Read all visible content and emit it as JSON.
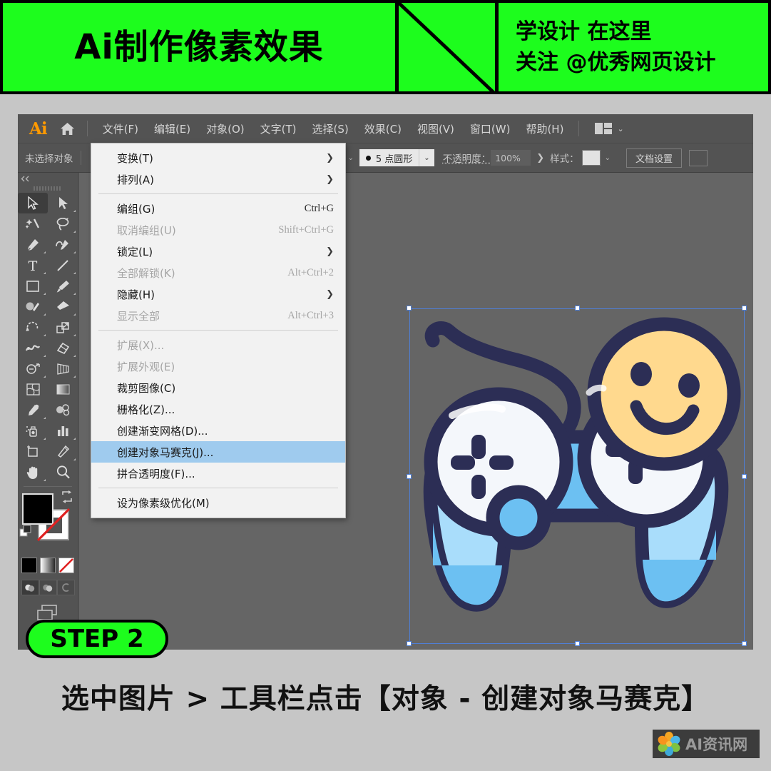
{
  "banner": {
    "title": "Ai制作像素效果",
    "sub_line1": "学设计 在这里",
    "sub_line2": "关注 @优秀网页设计",
    "bg_color": "#1dfd1d",
    "border_color": "#000000"
  },
  "app": {
    "logo": "Ai",
    "home_icon": "home-icon",
    "menu": [
      {
        "label": "文件(F)"
      },
      {
        "label": "编辑(E)"
      },
      {
        "label": "对象(O)"
      },
      {
        "label": "文字(T)"
      },
      {
        "label": "选择(S)"
      },
      {
        "label": "效果(C)"
      },
      {
        "label": "视图(V)"
      },
      {
        "label": "窗口(W)"
      },
      {
        "label": "帮助(H)"
      }
    ],
    "arrange_icon": "arrange-documents-icon",
    "arrange_chevron": "⌄"
  },
  "control_bar": {
    "selection_status": "未选择对象",
    "stroke_swatch_color": "#8f8f8f",
    "brush_label": "5 点圆形",
    "brush_bullet": "●",
    "opacity_label": "不透明度：",
    "opacity_value": "100%",
    "opacity_arrow": "❯",
    "style_label": "样式：",
    "style_swatch_color": "#e2e2e2",
    "document_setup_button": "文档设置"
  },
  "toolbar": {
    "collapse_icon": "double-chevron-left-icon",
    "tools": [
      {
        "name": "selection-tool",
        "glyph": "cursor-arrow",
        "selected": true,
        "corner": false
      },
      {
        "name": "direct-selection-tool",
        "glyph": "cursor-arrow-white",
        "selected": false,
        "corner": true
      },
      {
        "name": "magic-wand-tool",
        "glyph": "magic-wand",
        "selected": false,
        "corner": false
      },
      {
        "name": "lasso-tool",
        "glyph": "lasso",
        "selected": false,
        "corner": true
      },
      {
        "name": "pen-tool",
        "glyph": "pen",
        "selected": false,
        "corner": true
      },
      {
        "name": "curvature-tool",
        "glyph": "curvature",
        "selected": false,
        "corner": true
      },
      {
        "name": "type-tool",
        "glyph": "type-T",
        "selected": false,
        "corner": true
      },
      {
        "name": "line-segment-tool",
        "glyph": "line-segment",
        "selected": false,
        "corner": true
      },
      {
        "name": "rectangle-tool",
        "glyph": "rectangle",
        "selected": false,
        "corner": true
      },
      {
        "name": "paintbrush-tool",
        "glyph": "paintbrush",
        "selected": false,
        "corner": true
      },
      {
        "name": "shaper-tool",
        "glyph": "shaper-pencil",
        "selected": false,
        "corner": true
      },
      {
        "name": "eraser-tool",
        "glyph": "eraser",
        "selected": false,
        "corner": true
      },
      {
        "name": "rotate-tool",
        "glyph": "rotate",
        "selected": false,
        "corner": true
      },
      {
        "name": "scale-tool",
        "glyph": "scale",
        "selected": false,
        "corner": true
      },
      {
        "name": "width-tool",
        "glyph": "width-warp",
        "selected": false,
        "corner": true
      },
      {
        "name": "free-transform-tool",
        "glyph": "free-transform",
        "selected": false,
        "corner": true
      },
      {
        "name": "shape-builder-tool",
        "glyph": "shape-builder",
        "selected": false,
        "corner": true
      },
      {
        "name": "perspective-grid-tool",
        "glyph": "perspective-grid",
        "selected": false,
        "corner": true
      },
      {
        "name": "mesh-tool",
        "glyph": "mesh",
        "selected": false,
        "corner": false
      },
      {
        "name": "gradient-tool",
        "glyph": "gradient",
        "selected": false,
        "corner": false
      },
      {
        "name": "eyedropper-tool",
        "glyph": "eyedropper",
        "selected": false,
        "corner": true
      },
      {
        "name": "blend-tool",
        "glyph": "blend",
        "selected": false,
        "corner": false
      },
      {
        "name": "symbol-sprayer-tool",
        "glyph": "symbol-sprayer",
        "selected": false,
        "corner": true
      },
      {
        "name": "column-graph-tool",
        "glyph": "column-graph",
        "selected": false,
        "corner": true
      },
      {
        "name": "artboard-tool",
        "glyph": "artboard",
        "selected": false,
        "corner": false
      },
      {
        "name": "slice-tool",
        "glyph": "slice-knife",
        "selected": false,
        "corner": true
      },
      {
        "name": "hand-tool",
        "glyph": "hand",
        "selected": false,
        "corner": true
      },
      {
        "name": "zoom-tool",
        "glyph": "magnifier",
        "selected": false,
        "corner": false
      }
    ],
    "fill_color": "#000000",
    "stroke_color": "#ffffff",
    "swap_icon": "swap-fill-stroke-icon",
    "defaults_icon": "default-fill-stroke-icon",
    "none_icon": "none-slash-icon",
    "modes": [
      {
        "name": "color-mode",
        "label": "color"
      },
      {
        "name": "gradient-mode",
        "label": "gradient"
      },
      {
        "name": "none-mode",
        "label": "none"
      }
    ],
    "draw_modes": [
      {
        "name": "draw-normal-mode",
        "active": true
      },
      {
        "name": "draw-behind-mode",
        "active": false
      },
      {
        "name": "draw-inside-mode",
        "active": false
      }
    ],
    "screen_mode_icon": "change-screen-mode-icon"
  },
  "object_menu": {
    "items": [
      {
        "label": "变换(T)",
        "accel": "",
        "submenu": true,
        "disabled": false,
        "highlighted": false
      },
      {
        "label": "排列(A)",
        "accel": "",
        "submenu": true,
        "disabled": false,
        "highlighted": false
      },
      {
        "separator": true
      },
      {
        "label": "编组(G)",
        "accel": "Ctrl+G",
        "submenu": false,
        "disabled": false,
        "highlighted": false
      },
      {
        "label": "取消编组(U)",
        "accel": "Shift+Ctrl+G",
        "submenu": false,
        "disabled": true,
        "highlighted": false
      },
      {
        "label": "锁定(L)",
        "accel": "",
        "submenu": true,
        "disabled": false,
        "highlighted": false
      },
      {
        "label": "全部解锁(K)",
        "accel": "Alt+Ctrl+2",
        "submenu": false,
        "disabled": true,
        "highlighted": false
      },
      {
        "label": "隐藏(H)",
        "accel": "",
        "submenu": true,
        "disabled": false,
        "highlighted": false
      },
      {
        "label": "显示全部",
        "accel": "Alt+Ctrl+3",
        "submenu": false,
        "disabled": true,
        "highlighted": false
      },
      {
        "separator": true
      },
      {
        "label": "扩展(X)...",
        "accel": "",
        "submenu": false,
        "disabled": true,
        "highlighted": false
      },
      {
        "label": "扩展外观(E)",
        "accel": "",
        "submenu": false,
        "disabled": true,
        "highlighted": false
      },
      {
        "label": "裁剪图像(C)",
        "accel": "",
        "submenu": false,
        "disabled": false,
        "highlighted": false
      },
      {
        "label": "栅格化(Z)...",
        "accel": "",
        "submenu": false,
        "disabled": false,
        "highlighted": false
      },
      {
        "label": "创建渐变网格(D)...",
        "accel": "",
        "submenu": false,
        "disabled": false,
        "highlighted": false
      },
      {
        "label": "创建对象马赛克(J)...",
        "accel": "",
        "submenu": false,
        "disabled": false,
        "highlighted": true
      },
      {
        "label": "拼合透明度(F)...",
        "accel": "",
        "submenu": false,
        "disabled": false,
        "highlighted": false
      },
      {
        "separator": true
      },
      {
        "label": "设为像素级优化(M)",
        "accel": "",
        "submenu": false,
        "disabled": false,
        "highlighted": false
      }
    ],
    "highlight_color": "#9fcbee"
  },
  "artwork": {
    "name": "game-controller-illustration",
    "outline_color": "#2c2e55",
    "body_light_blue": "#a9ddfb",
    "body_blue": "#6cc0f2",
    "white": "#f4f7fb",
    "smiley_light": "#ffd98e",
    "smiley_dark": "#fbbf52",
    "selection_color": "#4f7fd6"
  },
  "step_badge": {
    "label": "STEP 2",
    "bg_color": "#1dfd1d"
  },
  "caption": {
    "text": "选中图片 > 工具栏点击【对象 - 创建对象马赛克】"
  },
  "watermark": {
    "text": "AI资讯网",
    "flower_icon": "flower-logo-icon"
  }
}
